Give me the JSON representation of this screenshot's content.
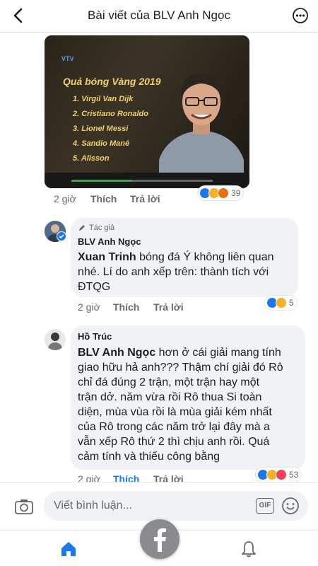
{
  "header": {
    "title": "Bài viết của BLV Anh Ngọc"
  },
  "video": {
    "channel": "VTV",
    "overlay_title": "Quả bóng Vàng 2019",
    "list": [
      "1. Virgil Van Dijk",
      "2. Cristiano Ronaldo",
      "3. Lionel Messi",
      "4. Sandio Mané",
      "5. Alisson"
    ],
    "progress": 0.43
  },
  "post_meta": {
    "time": "2 giờ",
    "like": "Thích",
    "reply": "Trả lời",
    "reaction_count": "39"
  },
  "comments": [
    {
      "badge": "Tác giả",
      "name": "BLV Anh Ngọc",
      "mention": "Xuan Trinh",
      "text_lines": [
        " bóng đá Ý không liên quan",
        "nhé. Lí do anh xếp trên: thành tích với",
        "ĐTQG"
      ],
      "time": "2 giờ",
      "like": "Thích",
      "reply": "Trả lời",
      "reaction_count": "5"
    },
    {
      "name": "Hồ Trúc",
      "mention": "BLV Anh Ngọc",
      "text_lines": [
        " hơn ở cái giải mang tính",
        "giao hữu hả anh??? Thậm chí giải đó Rô",
        "chỉ đá đúng 2 trận, một trận hay một",
        "trận dở. năm vừa rồi Rô thua Si toàn",
        "diện, mùa vùa rồi là mùa giải kém nhất",
        "của Rô trong các năm trở lại đây mà a",
        "vẫn xếp Rô thứ 2 thì chịu anh rồi. Quá",
        "cảm tính và thiếu công bằng"
      ],
      "time": "2 giờ",
      "like": "Thích",
      "reply": "Trả lời",
      "reaction_count": "53"
    }
  ],
  "composer": {
    "placeholder": "Viết bình luận...",
    "gif_label": "GIF"
  },
  "colors": {
    "link_blue": "#1877f2",
    "bubble_bg": "#f0f2f5",
    "meta_gray": "#65676b"
  }
}
